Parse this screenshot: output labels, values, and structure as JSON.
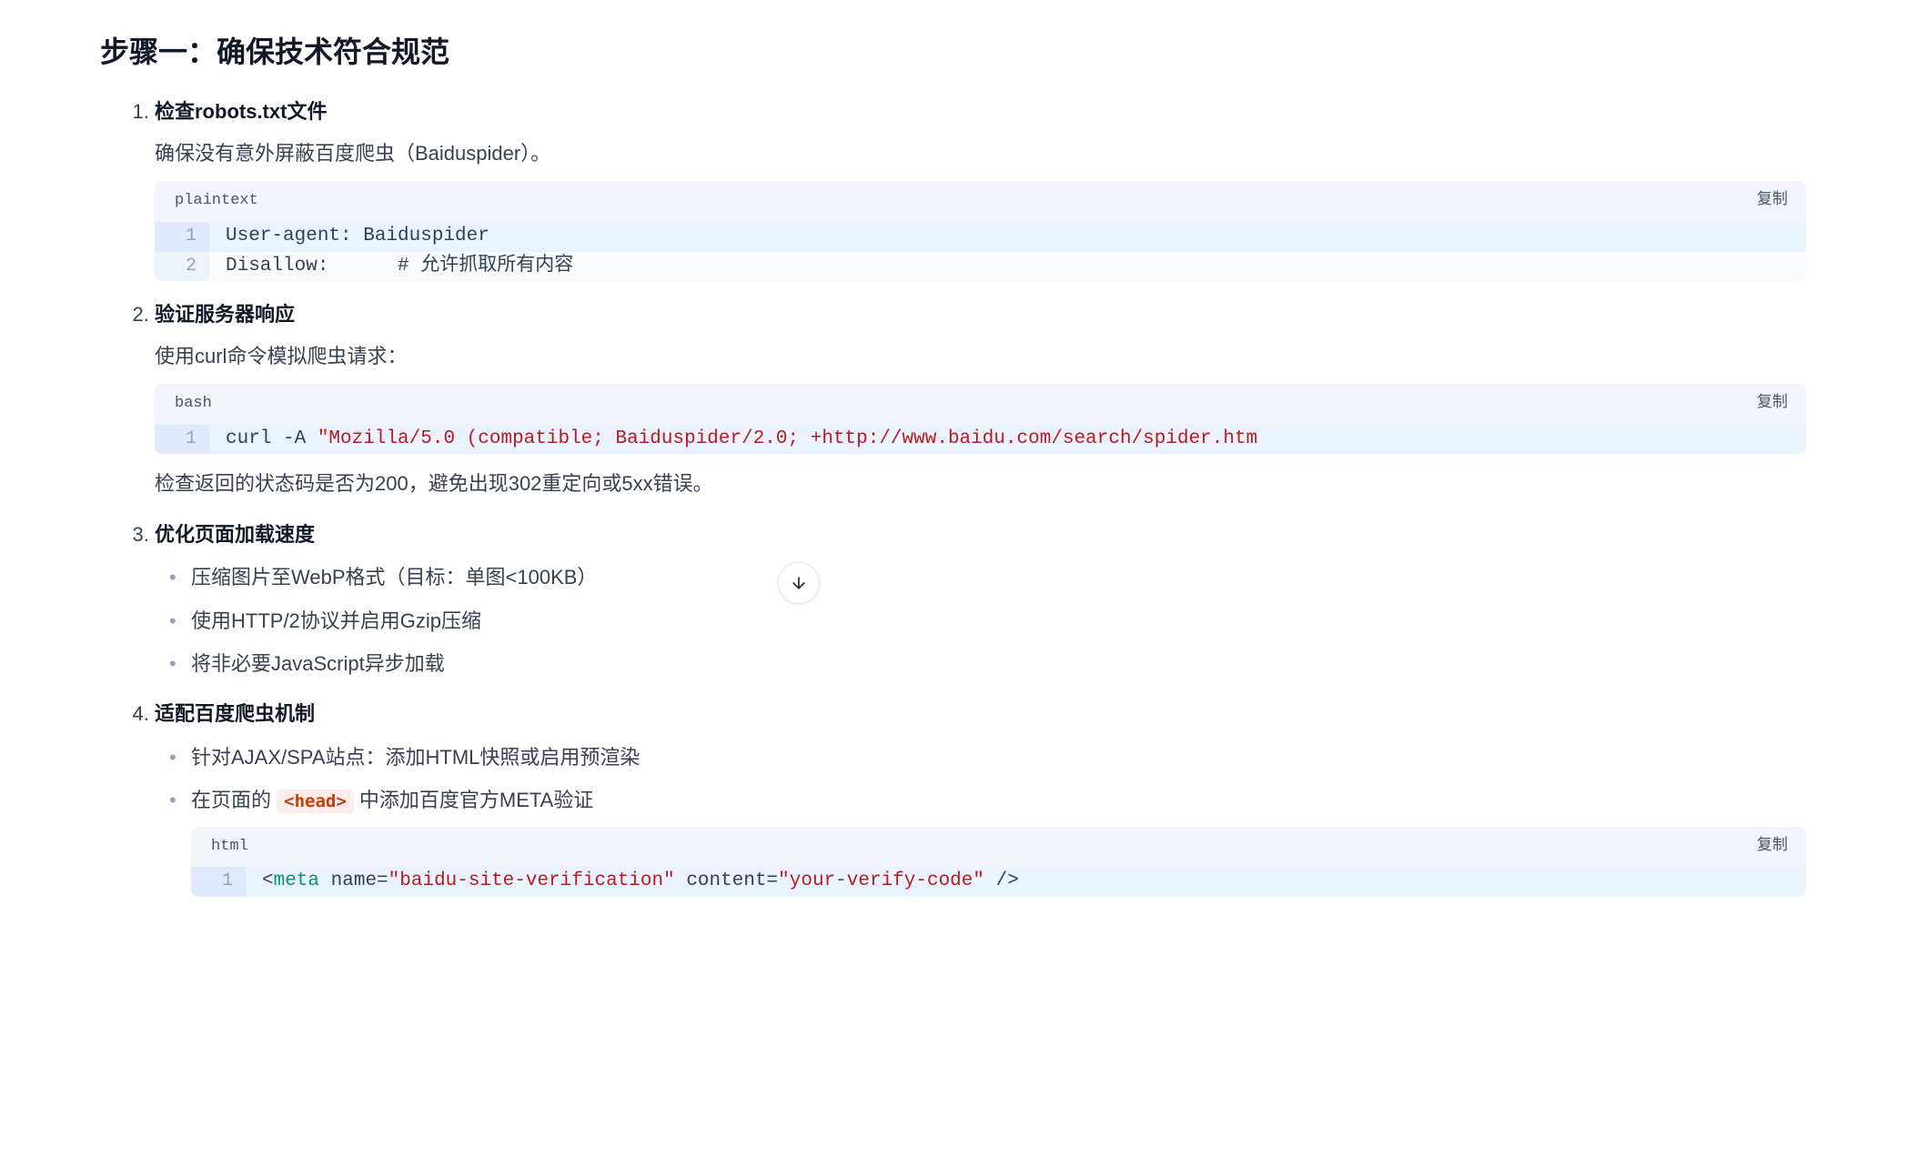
{
  "heading": "步骤一：确保技术符合规范",
  "copy_label": "复制",
  "items": [
    {
      "title": "检查robots.txt文件",
      "desc": "确保没有意外屏蔽百度爬虫（Baiduspider）。",
      "code": {
        "lang": "plaintext",
        "lines": [
          {
            "n": "1",
            "hl": true,
            "plain": "User-agent: Baiduspider"
          },
          {
            "n": "2",
            "hl": false,
            "plain": "Disallow:      # 允许抓取所有内容"
          }
        ]
      }
    },
    {
      "title": "验证服务器响应",
      "desc": "使用curl命令模拟爬虫请求：",
      "code": {
        "lang": "bash",
        "lines": [
          {
            "n": "1",
            "hl": true,
            "cmd": "curl -A ",
            "str": "\"Mozilla/5.0 (compatible; Baiduspider/2.0; +http://www.baidu.com/search/spider.htm"
          }
        ]
      },
      "after_text": "检查返回的状态码是否为200，避免出现302重定向或5xx错误。"
    },
    {
      "title": "优化页面加载速度",
      "bullets": [
        "压缩图片至WebP格式（目标：单图<100KB）",
        "使用HTTP/2协议并启用Gzip压缩",
        "将非必要JavaScript异步加载"
      ]
    },
    {
      "title": "适配百度爬虫机制",
      "bullets_complex": [
        {
          "text": "针对AJAX/SPA站点：添加HTML快照或启用预渲染"
        },
        {
          "before": "在页面的 ",
          "code": "<head>",
          "after": " 中添加百度官方META验证"
        }
      ],
      "code": {
        "lang": "html",
        "lines": [
          {
            "n": "1",
            "hl": true,
            "html_tokens": {
              "lt": "<",
              "tag": "meta",
              "sp1": " ",
              "attr1": "name=",
              "val1": "\"baidu-site-verification\"",
              "sp2": " ",
              "attr2": "content=",
              "val2": "\"your-verify-code\"",
              "close": " />"
            }
          }
        ]
      }
    }
  ]
}
